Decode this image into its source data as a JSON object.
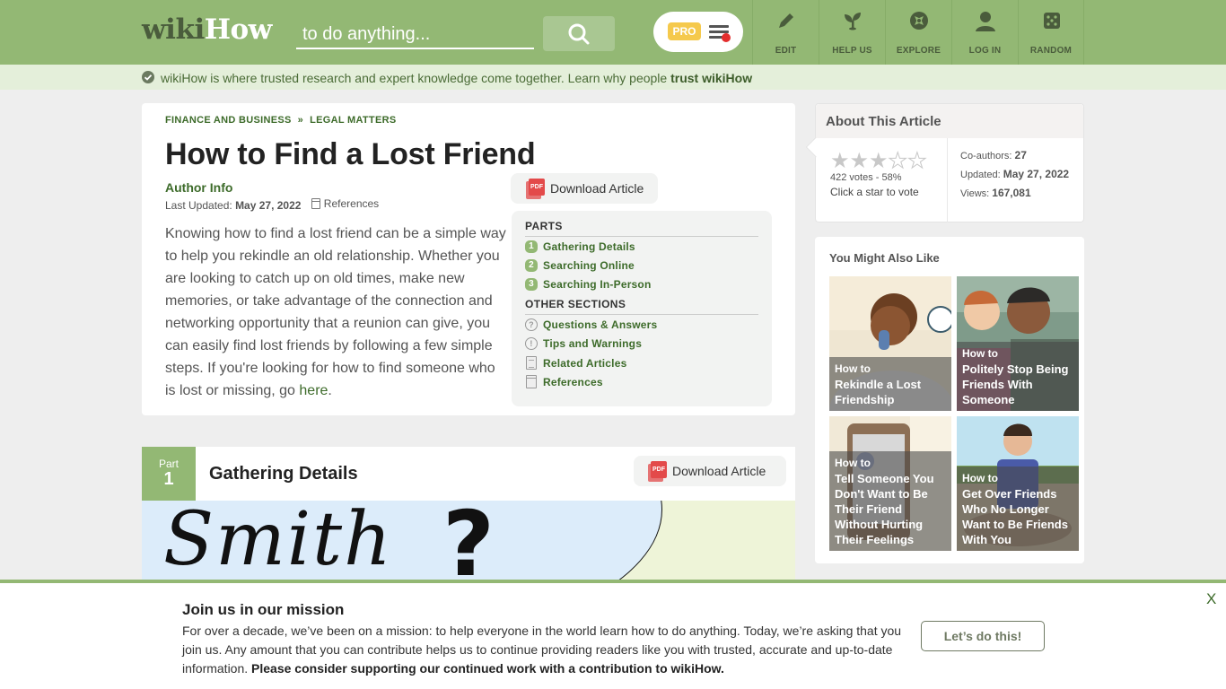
{
  "header": {
    "logo_wiki": "wiki",
    "logo_how": "How",
    "search_value": "to do anything...",
    "search_button_icon": "search-icon",
    "pro_label": "PRO",
    "menu_icon": "hamburger-menu-icon",
    "nav": [
      {
        "label": "EDIT",
        "icon": "pencil-icon"
      },
      {
        "label": "HELP US",
        "icon": "sprout-icon"
      },
      {
        "label": "EXPLORE",
        "icon": "compass-icon"
      },
      {
        "label": "LOG IN",
        "icon": "user-icon"
      },
      {
        "label": "RANDOM",
        "icon": "dice-icon"
      }
    ]
  },
  "trust_bar": {
    "text": "wikiHow is where trusted research and expert knowledge come together. Learn why people ",
    "link": "trust wikiHow"
  },
  "article": {
    "breadcrumb": [
      "FINANCE AND BUSINESS",
      "LEGAL MATTERS"
    ],
    "breadcrumb_separator": "»",
    "title": "How to Find a Lost Friend",
    "author_info": "Author Info",
    "last_updated_label": "Last Updated: ",
    "last_updated": "May 27, 2022",
    "references_label": "References",
    "download_label": "Download Article",
    "intro": "Knowing how to find a lost friend can be a simple way to help you rekindle an old relationship. Whether you are looking to catch up on old times, make new memories, or take advantage of the connection and networking opportunity that a reunion can give, you can easily find lost friends by following a few simple steps. If you're looking for how to find someone who is lost or missing, go ",
    "intro_link": "here",
    "intro_end": "."
  },
  "toc": {
    "parts_heading": "PARTS",
    "parts": [
      {
        "num": "1",
        "label": "Gathering Details"
      },
      {
        "num": "2",
        "label": "Searching Online"
      },
      {
        "num": "3",
        "label": "Searching In-Person"
      }
    ],
    "other_heading": "OTHER SECTIONS",
    "other": [
      {
        "label": "Questions & Answers",
        "icon": "question-circle-icon",
        "glyph": "?"
      },
      {
        "label": "Tips and Warnings",
        "icon": "exclamation-circle-icon",
        "glyph": "!"
      },
      {
        "label": "Related Articles",
        "icon": "document-icon"
      },
      {
        "label": "References",
        "icon": "references-icon"
      }
    ]
  },
  "part1": {
    "label": "Part",
    "number": "1",
    "title": "Gathering Details",
    "download_label": "Download Article",
    "image_text": "Smith",
    "image_mark": "?"
  },
  "about": {
    "title": "About This Article",
    "rating_stars_filled": 3,
    "rating_stars_total": 5,
    "votes": "422 votes - 58%",
    "vote_cta": "Click a star to vote",
    "coauthors_label": "Co-authors: ",
    "coauthors": "27",
    "updated_label": "Updated: ",
    "updated": "May 27, 2022",
    "views_label": "Views: ",
    "views": "167,081"
  },
  "also_like": {
    "title": "You Might Also Like",
    "items": [
      {
        "prefix": "How to",
        "title": "Rekindle a Lost Friendship"
      },
      {
        "prefix": "How to",
        "title": "Politely Stop Being Friends With Someone"
      },
      {
        "prefix": "How to",
        "title": "Tell Someone You Don't Want to Be Their Friend Without Hurting Their Feelings"
      },
      {
        "prefix": "How to",
        "title": "Get Over Friends Who No Longer Want to Be Friends With You"
      }
    ]
  },
  "banner": {
    "title": "Join us in our mission",
    "text": "For over a decade, we’ve been on a mission: to help everyone in the world learn how to do anything. Today, we’re asking that you join us. Any amount that you can contribute helps us to continue providing readers like you with trusted, accurate and up-to-date information. ",
    "text_bold": "Please consider supporting our continued work with a contribution to wikiHow.",
    "cta": "Let’s do this!",
    "close": "X"
  },
  "colors": {
    "brand_green": "#93b874",
    "link_green": "#3d6b2a",
    "pro_yellow": "#f5c94c",
    "pdf_red": "#e34a4a",
    "notification_red": "#e32d2d"
  }
}
